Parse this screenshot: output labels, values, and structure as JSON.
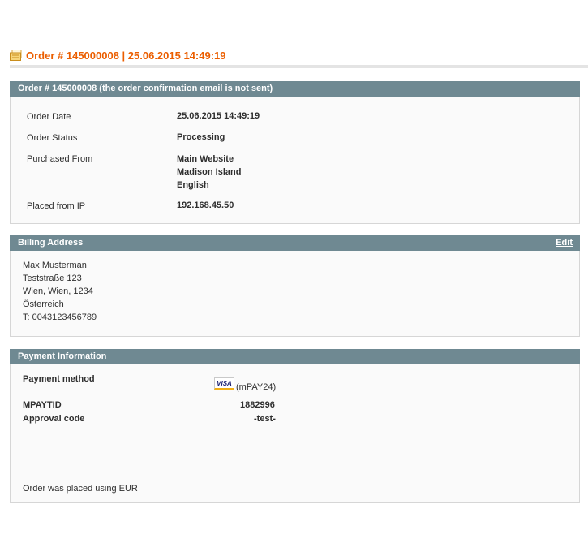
{
  "page_title": "Order # 145000008 | 25.06.2015 14:49:19",
  "order_box": {
    "title": "Order # 145000008 (the order confirmation email is not sent)",
    "rows": [
      {
        "label": "Order Date",
        "values": [
          "25.06.2015 14:49:19"
        ]
      },
      {
        "label": "Order Status",
        "values": [
          "Processing"
        ]
      },
      {
        "label": "Purchased From",
        "values": [
          "Main Website",
          "Madison Island",
          "English"
        ]
      },
      {
        "label": "Placed from IP",
        "values": [
          "192.168.45.50"
        ]
      }
    ]
  },
  "billing": {
    "title": "Billing Address",
    "edit_label": "Edit",
    "lines": [
      "Max Musterman",
      "Teststraße 123",
      "Wien, Wien, 1234",
      "Österreich",
      "T: 0043123456789"
    ]
  },
  "payment": {
    "title": "Payment Information",
    "method_label": "Payment method",
    "card_logo": "VISA",
    "method_value": "(mPAY24)",
    "mpaytid_label": "MPAYTID",
    "mpaytid_value": "1882996",
    "approval_label": "Approval code",
    "approval_value": "-test-",
    "currency_note": "Order was placed using EUR"
  },
  "icons": {
    "page_head": "order-icon",
    "card": "visa-card-icon"
  },
  "colors": {
    "title": "#eb5e00",
    "section_header": "#6f8992"
  }
}
